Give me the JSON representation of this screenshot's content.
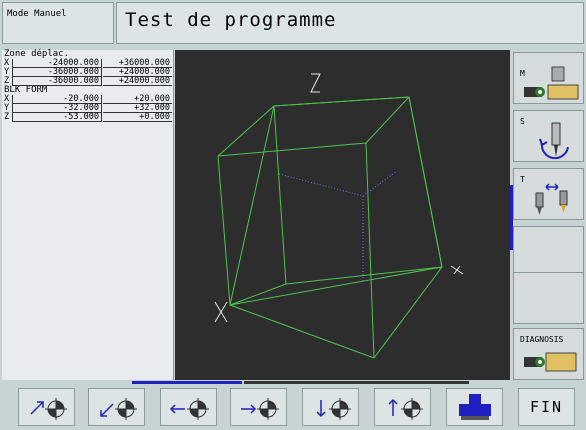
{
  "header": {
    "mode": "Mode Manuel",
    "title": "Test de programme"
  },
  "zone": {
    "title": "Zone déplac.",
    "rows": [
      {
        "axis": "X",
        "min": "-24000.000",
        "max": "+36000.000"
      },
      {
        "axis": "Y",
        "min": "-36000.000",
        "max": "+24000.000"
      },
      {
        "axis": "Z",
        "min": "-36000.000",
        "max": "+24000.000"
      }
    ]
  },
  "blk": {
    "title": "BLK FORM",
    "rows": [
      {
        "axis": "X",
        "min": "-20.000",
        "max": "+20.000"
      },
      {
        "axis": "Y",
        "min": "-32.000",
        "max": "+32.000"
      },
      {
        "axis": "Z",
        "min": "-53.000",
        "max": "+0.000"
      }
    ]
  },
  "softkeys": {
    "m": "M",
    "s": "S",
    "t": "T",
    "diagnosis": "DIAGNOSIS"
  },
  "bottom": {
    "fin": "FIN"
  },
  "icons": {
    "m": "spindle-machine-icon",
    "s": "spindle-speed-icon",
    "t": "tool-change-icon",
    "diagnosis": "diagnosis-icon",
    "jog": "jog-direction-icon",
    "save": "save-icon"
  },
  "colors": {
    "accent": "#2020c0",
    "wireframe": "#4fc44f"
  }
}
